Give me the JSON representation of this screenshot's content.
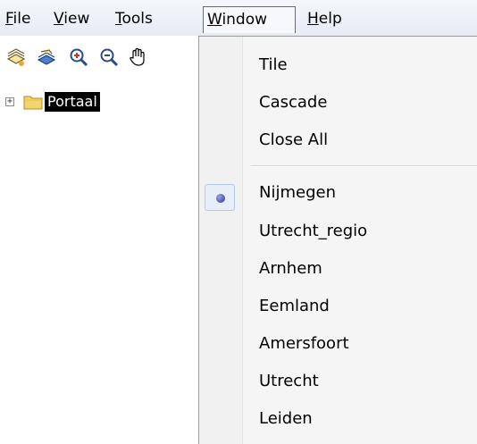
{
  "menubar": {
    "file": {
      "mnemonic": "F",
      "rest": "ile"
    },
    "view": {
      "mnemonic": "V",
      "rest": "iew"
    },
    "tools": {
      "mnemonic": "T",
      "rest": "ools"
    },
    "window": {
      "mnemonic": "W",
      "rest": "indow"
    },
    "help": {
      "mnemonic": "H",
      "rest": "elp"
    }
  },
  "toolbar": {
    "icons": [
      "layer-add-icon",
      "layer-open-icon",
      "zoom-in-icon",
      "zoom-out-icon",
      "pan-hand-icon"
    ]
  },
  "tree": {
    "expander": "+",
    "root_label": "Portaal"
  },
  "window_menu": {
    "commands": [
      "Tile",
      "Cascade",
      "Close All"
    ],
    "windows": [
      "Nijmegen",
      "Utrecht_regio",
      "Arnhem",
      "Eemland",
      "Amersfoort",
      "Utrecht",
      "Leiden"
    ],
    "checked": "Nijmegen"
  },
  "colors": {
    "menubar_bg": "#e9eef7",
    "selection_bg": "#000000",
    "radio_dot": "#3a3fa0"
  }
}
